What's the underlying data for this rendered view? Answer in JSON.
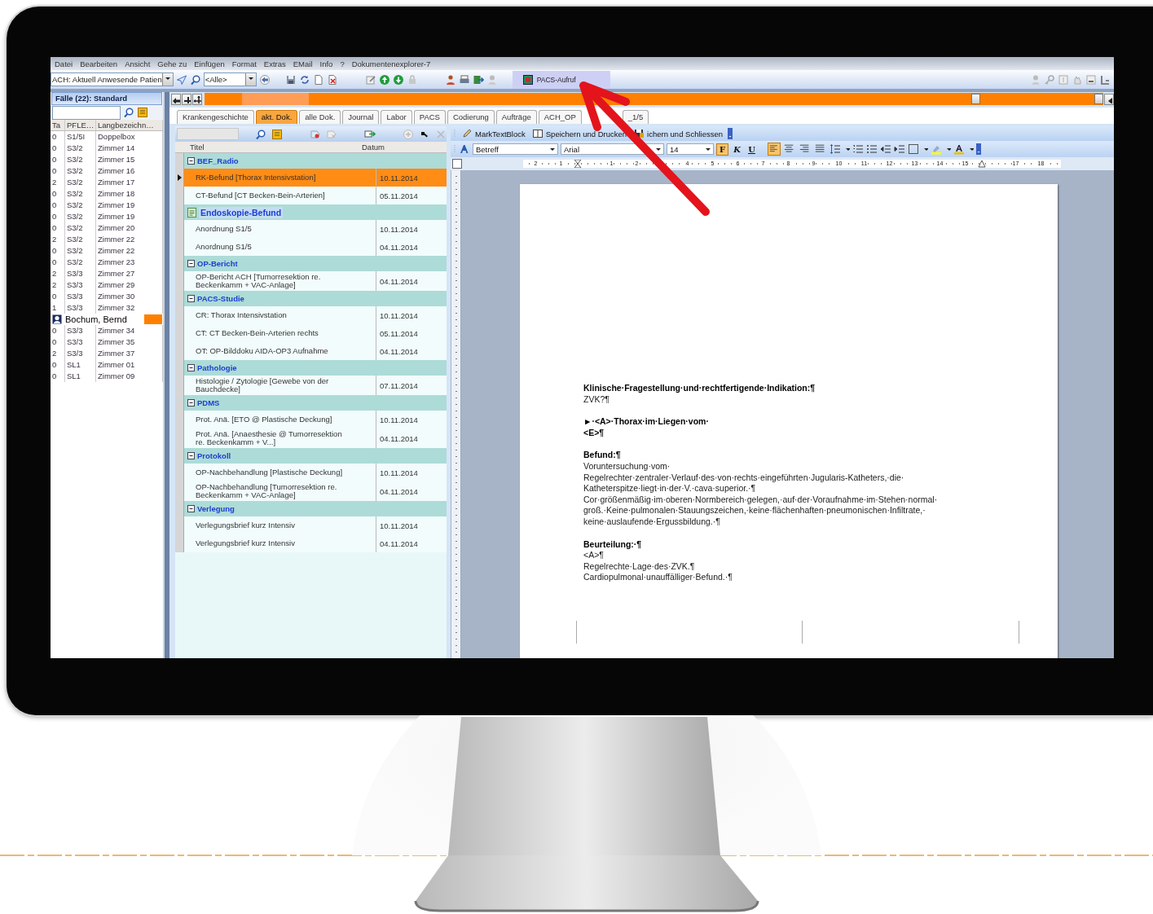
{
  "menu": [
    "Datei",
    "Bearbeiten",
    "Ansicht",
    "Gehe zu",
    "Einfügen",
    "Format",
    "Extras",
    "EMail",
    "Info",
    "?",
    "Dokumentenexplorer-7"
  ],
  "toolbar": {
    "patient_filter": "ACH: Aktuell Anwesende Patien",
    "category_filter": "<Alle>",
    "pacs_button": "PACS-Aufruf"
  },
  "cases": {
    "title": "Fälle (22): Standard",
    "columns": [
      "Ta",
      "PFLE…",
      "Langbezeichn…"
    ],
    "rows": [
      {
        "kind": "room",
        "ta": "0",
        "pfle": "S1/5I",
        "name": "Doppelbox"
      },
      {
        "kind": "room",
        "ta": "0",
        "pfle": "S3/2",
        "name": "Zimmer 14"
      },
      {
        "kind": "room",
        "ta": "0",
        "pfle": "S3/2",
        "name": "Zimmer 15"
      },
      {
        "kind": "room",
        "ta": "0",
        "pfle": "S3/2",
        "name": "Zimmer 16"
      },
      {
        "kind": "room",
        "ta": "2",
        "pfle": "S3/2",
        "name": "Zimmer 17"
      },
      {
        "kind": "room",
        "ta": "0",
        "pfle": "S3/2",
        "name": "Zimmer 18"
      },
      {
        "kind": "room",
        "ta": "0",
        "pfle": "S3/2",
        "name": "Zimmer 19"
      },
      {
        "kind": "room",
        "ta": "0",
        "pfle": "S3/2",
        "name": "Zimmer 19"
      },
      {
        "kind": "room",
        "ta": "0",
        "pfle": "S3/2",
        "name": "Zimmer 20"
      },
      {
        "kind": "room",
        "ta": "2",
        "pfle": "S3/2",
        "name": "Zimmer 22"
      },
      {
        "kind": "room",
        "ta": "0",
        "pfle": "S3/2",
        "name": "Zimmer 22"
      },
      {
        "kind": "room",
        "ta": "0",
        "pfle": "S3/2",
        "name": "Zimmer 23"
      },
      {
        "kind": "room",
        "ta": "2",
        "pfle": "S3/3",
        "name": "Zimmer 27"
      },
      {
        "kind": "room",
        "ta": "2",
        "pfle": "S3/3",
        "name": "Zimmer 29"
      },
      {
        "kind": "room",
        "ta": "0",
        "pfle": "S3/3",
        "name": "Zimmer 30"
      },
      {
        "kind": "room",
        "ta": "1",
        "pfle": "S3/3",
        "name": "Zimmer 32"
      },
      {
        "kind": "patient",
        "name": "Bochum, Bernd"
      },
      {
        "kind": "room",
        "ta": "0",
        "pfle": "S3/3",
        "name": "Zimmer 34"
      },
      {
        "kind": "room",
        "ta": "0",
        "pfle": "S3/3",
        "name": "Zimmer 35"
      },
      {
        "kind": "room",
        "ta": "2",
        "pfle": "S3/3",
        "name": "Zimmer 37"
      },
      {
        "kind": "room",
        "ta": "0",
        "pfle": "SL1",
        "name": "Zimmer 01"
      },
      {
        "kind": "room",
        "ta": "0",
        "pfle": "SL1",
        "name": "Zimmer 09"
      }
    ]
  },
  "tabs": [
    {
      "label": "Krankengeschichte",
      "selected": false
    },
    {
      "label": "akt. Dok.",
      "selected": true
    },
    {
      "label": "alle Dok.",
      "selected": false
    },
    {
      "label": "Journal",
      "selected": false
    },
    {
      "label": "Labor",
      "selected": false
    },
    {
      "label": "PACS",
      "selected": false
    },
    {
      "label": "Codierung",
      "selected": false
    },
    {
      "label": "Aufträge",
      "selected": false
    },
    {
      "label": "ACH_OP",
      "selected": false
    },
    {
      "label": "_1/5",
      "selected": false
    }
  ],
  "documents": {
    "columns": [
      "Titel",
      "Datum"
    ],
    "groups": [
      {
        "title": "BEF_Radio",
        "kind": "expander",
        "children": [
          {
            "title": "RK-Befund [Thorax Intensivstation]",
            "date": "10.11.2014",
            "selected": true
          },
          {
            "title": "CT-Befund [CT Becken-Bein-Arterien]",
            "date": "05.11.2014",
            "selected": false
          }
        ]
      },
      {
        "title": "Endoskopie-Befund",
        "kind": "document",
        "children": [
          {
            "title": "Anordnung S1/5",
            "date": "10.11.2014",
            "selected": false
          },
          {
            "title": "Anordnung S1/5",
            "date": "04.11.2014",
            "selected": false
          }
        ]
      },
      {
        "title": "OP-Bericht",
        "kind": "expander",
        "children": [
          {
            "title": "OP-Bericht ACH [Tumorresektion re. Beckenkamm + VAC-Anlage]",
            "date": "04.11.2014",
            "selected": false
          }
        ]
      },
      {
        "title": "PACS-Studie",
        "kind": "expander",
        "children": [
          {
            "title": "CR: Thorax Intensivstation",
            "date": "10.11.2014",
            "selected": false
          },
          {
            "title": "CT: CT Becken-Bein-Arterien rechts",
            "date": "05.11.2014",
            "selected": false
          },
          {
            "title": "OT: OP-Bilddoku AIDA-OP3 Aufnahme",
            "date": "04.11.2014",
            "selected": false
          }
        ]
      },
      {
        "title": "Pathologie",
        "kind": "expander",
        "children": [
          {
            "title": "Histologie / Zytologie [Gewebe von der Bauchdecke]",
            "date": "07.11.2014",
            "selected": false
          }
        ]
      },
      {
        "title": "PDMS",
        "kind": "expander",
        "children": [
          {
            "title": "Prot. Anä. [ETO @ Plastische Deckung]",
            "date": "10.11.2014",
            "selected": false
          },
          {
            "title": "Prot. Anä. [Anaesthesie @ Tumorresektion re. Beckenkamm + V...]",
            "date": "04.11.2014",
            "selected": false
          }
        ]
      },
      {
        "title": "Protokoll",
        "kind": "expander",
        "children": [
          {
            "title": "OP-Nachbehandlung [Plastische Deckung]",
            "date": "10.11.2014",
            "selected": false
          },
          {
            "title": "OP-Nachbehandlung [Tumorresektion re. Beckenkamm + VAC-Anlage]",
            "date": "04.11.2014",
            "selected": false
          }
        ]
      },
      {
        "title": "Verlegung",
        "kind": "expander",
        "children": [
          {
            "title": "Verlegungsbrief kurz Intensiv",
            "date": "10.11.2014",
            "selected": false
          },
          {
            "title": "Verlegungsbrief kurz Intensiv",
            "date": "04.11.2014",
            "selected": false
          }
        ]
      }
    ]
  },
  "editor": {
    "toolbar": [
      "MarkTextBlock",
      "Speichern und Drucken",
      "ichern und Schliessen"
    ],
    "style": "Betreff",
    "font": "Arial",
    "size": "14",
    "format_buttons": [
      {
        "label": "F",
        "on": true
      },
      {
        "label": "K",
        "on": false
      },
      {
        "label": "U",
        "on": false
      }
    ],
    "alignment": [
      {
        "kind": "left",
        "on": true
      },
      {
        "kind": "center",
        "on": false
      },
      {
        "kind": "right",
        "on": false
      },
      {
        "kind": "justify",
        "on": false
      }
    ],
    "ruler": [
      "2",
      "1",
      "1",
      "2",
      "4",
      "5",
      "6",
      "7",
      "8",
      "9",
      "10",
      "11",
      "12",
      "13",
      "14",
      "15",
      "17",
      "18"
    ],
    "blocks": [
      {
        "lines": [
          {
            "text": "Klinische·Fragestellung·und·rechtfertigende·Indikation:¶",
            "bold": true
          },
          {
            "text": "ZVK?¶",
            "bold": false
          }
        ]
      },
      {
        "lines": [
          {
            "text": "►·<A>·Thorax·im·Liegen·vom·",
            "bold": true
          },
          {
            "text": "<E>¶",
            "bold": true
          }
        ]
      },
      {
        "lines": [
          {
            "text": "Befund:¶",
            "bold": true
          },
          {
            "text": "Voruntersuchung·vom·",
            "bold": false
          },
          {
            "text": "Regelrechter·zentraler·Verlauf·des·von·rechts·eingeführten·Jugularis-Katheters,·die·",
            "bold": false
          },
          {
            "text": "Katheterspitze·liegt·in·der·V.·cava·superior.·¶",
            "bold": false
          },
          {
            "text": "Cor·größenmäßig·im·oberen·Normbereich·gelegen,·auf·der·Voraufnahme·im·Stehen·normal·",
            "bold": false
          },
          {
            "text": "groß.·Keine·pulmonalen·Stauungszeichen,·keine·flächenhaften·pneumonischen·Infiltrate,·",
            "bold": false
          },
          {
            "text": "keine·auslaufende·Ergussbildung.·¶",
            "bold": false
          }
        ]
      },
      {
        "lines": [
          {
            "text": "Beurteilung:·¶",
            "bold": true
          },
          {
            "text": "<A>¶",
            "bold": false
          },
          {
            "text": "Regelrechte·Lage·des·ZVK.¶",
            "bold": false
          },
          {
            "text": "Cardiopulmonal·unauffälliger·Befund.·¶",
            "bold": false
          }
        ]
      }
    ]
  }
}
